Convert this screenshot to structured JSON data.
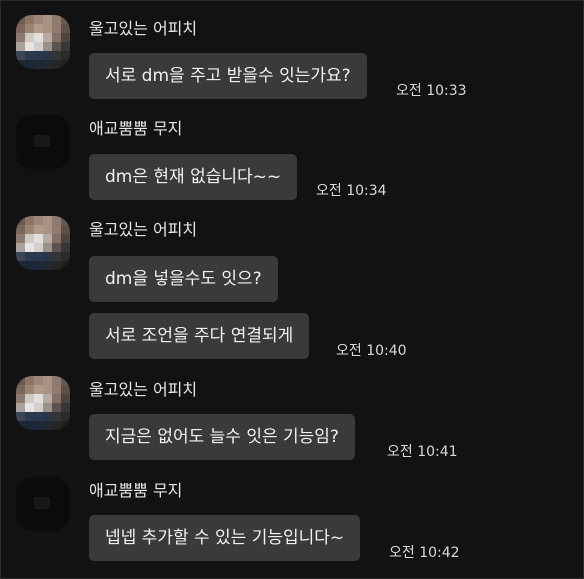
{
  "messages": [
    {
      "sender": "울고있는 어피치",
      "text": "서로 dm을 주고 받을수 잇는가요?",
      "time": "오전 10:33"
    },
    {
      "sender": "애교뿜뿜 무지",
      "text": "dm은 현재 없습니다~~",
      "time": "오전 10:34"
    },
    {
      "sender": "울고있는 어피치",
      "text_1": "dm을 넣을수도 잇으?",
      "text_2": "서로 조언을 주다 연결되게",
      "time": "오전 10:40"
    },
    {
      "sender": "울고있는 어피치",
      "text": "지금은 없어도 늘수 잇은 기능임?",
      "time": "오전 10:41"
    },
    {
      "sender": "애교뿜뿜 무지",
      "text": "넵넵 추가할 수 있는 기능입니다~",
      "time": "오전 10:42"
    }
  ],
  "avatars": {
    "apeach": "pixelated-profile-photo",
    "muzi": "dark-profile-photo"
  }
}
